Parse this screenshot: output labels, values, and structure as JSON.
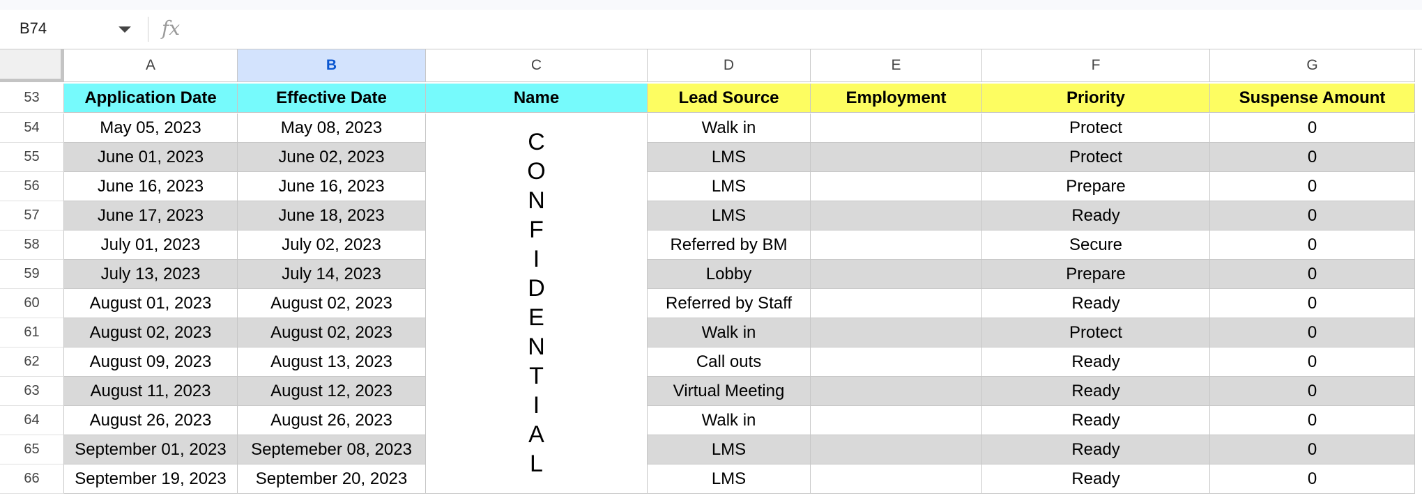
{
  "formula_bar": {
    "cell_ref": "B74",
    "fx_label": "fx"
  },
  "columns": [
    "A",
    "B",
    "C",
    "D",
    "E",
    "F",
    "G"
  ],
  "selected_column": "B",
  "header_row": {
    "row_number": "53",
    "cells": [
      "Application Date",
      "Effective Date",
      "Name",
      "Lead Source",
      "Employment",
      "Priority",
      "Suspense Amount"
    ]
  },
  "rows": [
    {
      "num": "54",
      "a": "May 05, 2023",
      "b": "May 08, 2023",
      "d": "Walk in",
      "e": "",
      "f": "Protect",
      "g": "0"
    },
    {
      "num": "55",
      "a": "June 01, 2023",
      "b": "June 02, 2023",
      "d": "LMS",
      "e": "",
      "f": "Protect",
      "g": "0"
    },
    {
      "num": "56",
      "a": "June 16, 2023",
      "b": "June 16, 2023",
      "d": "LMS",
      "e": "",
      "f": "Prepare",
      "g": "0"
    },
    {
      "num": "57",
      "a": "June 17, 2023",
      "b": "June 18, 2023",
      "d": "LMS",
      "e": "",
      "f": "Ready",
      "g": "0"
    },
    {
      "num": "58",
      "a": "July 01, 2023",
      "b": "July 02, 2023",
      "d": "Referred by BM",
      "e": "",
      "f": "Secure",
      "g": "0"
    },
    {
      "num": "59",
      "a": "July 13, 2023",
      "b": "July 14, 2023",
      "d": "Lobby",
      "e": "",
      "f": "Prepare",
      "g": "0"
    },
    {
      "num": "60",
      "a": "August 01, 2023",
      "b": "August 02, 2023",
      "d": "Referred by Staff",
      "e": "",
      "f": "Ready",
      "g": "0"
    },
    {
      "num": "61",
      "a": "August 02, 2023",
      "b": "August 02, 2023",
      "d": "Walk in",
      "e": "",
      "f": "Protect",
      "g": "0"
    },
    {
      "num": "62",
      "a": "August 09, 2023",
      "b": "August 13, 2023",
      "d": "Call outs",
      "e": "",
      "f": "Ready",
      "g": "0"
    },
    {
      "num": "63",
      "a": "August 11, 2023",
      "b": "August 12, 2023",
      "d": "Virtual Meeting",
      "e": "",
      "f": "Ready",
      "g": "0"
    },
    {
      "num": "64",
      "a": "August 26, 2023",
      "b": "August 26, 2023",
      "d": "Walk in",
      "e": "",
      "f": "Ready",
      "g": "0"
    },
    {
      "num": "65",
      "a": "September 01, 2023",
      "b": "Septemeber 08, 2023",
      "d": "LMS",
      "e": "",
      "f": "Ready",
      "g": "0"
    },
    {
      "num": "66",
      "a": "September 19, 2023",
      "b": "September 20, 2023",
      "d": "LMS",
      "e": "",
      "f": "Ready",
      "g": "0"
    }
  ],
  "merged_name_cell": [
    "C",
    "O",
    "N",
    "F",
    "I",
    "D",
    "E",
    "N",
    "T",
    "I",
    "A",
    "L"
  ],
  "colors": {
    "header_cyan": "#76fafc",
    "header_yellow": "#fdfd61",
    "band_gray": "#d9d9d9",
    "selected_col": "#d3e3fd"
  }
}
